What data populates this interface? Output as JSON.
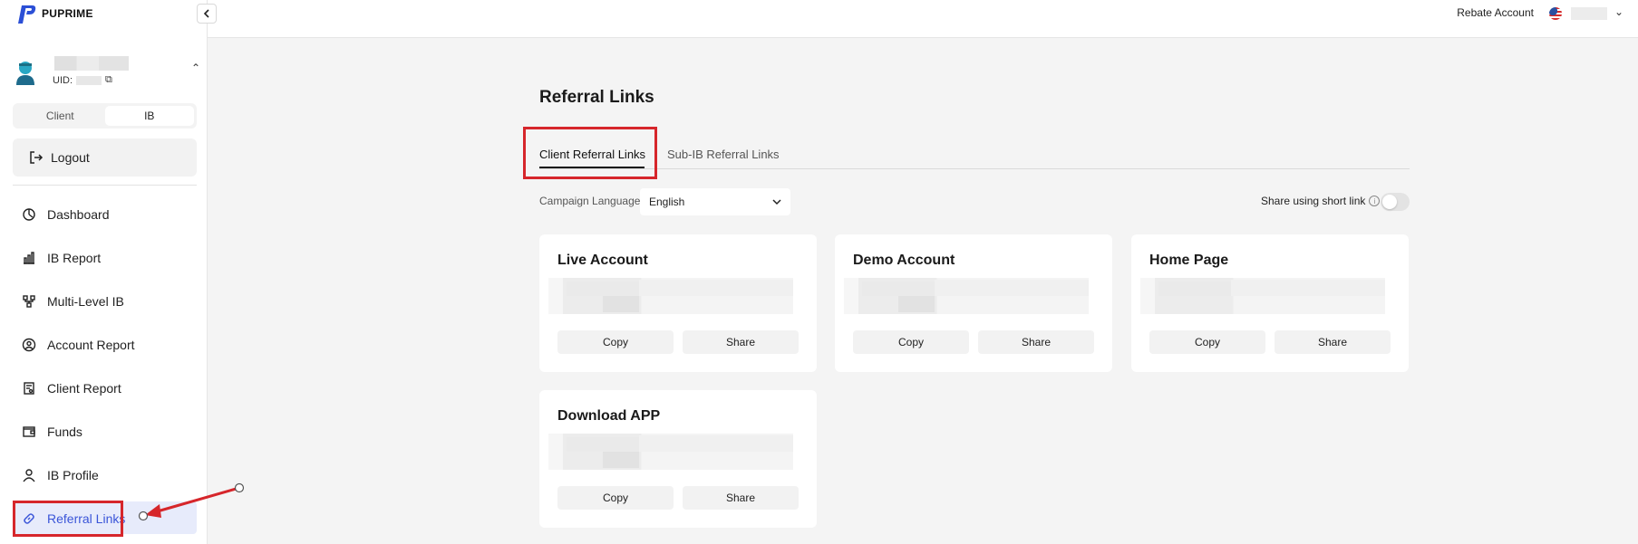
{
  "app": {
    "logo_text": "PUPRIME"
  },
  "user": {
    "uid_label": "UID:"
  },
  "role_switch": {
    "options": [
      "Client",
      "IB"
    ],
    "active": "IB"
  },
  "logout": {
    "label": "Logout"
  },
  "nav": {
    "items": [
      {
        "label": "Dashboard",
        "icon": "dashboard-icon"
      },
      {
        "label": "IB Report",
        "icon": "bar-chart-icon"
      },
      {
        "label": "Multi-Level IB",
        "icon": "hierarchy-icon"
      },
      {
        "label": "Account Report",
        "icon": "account-circle-icon"
      },
      {
        "label": "Client Report",
        "icon": "report-icon"
      },
      {
        "label": "Funds",
        "icon": "wallet-icon"
      },
      {
        "label": "IB Profile",
        "icon": "person-icon"
      },
      {
        "label": "Referral Links",
        "icon": "link-icon",
        "active": true
      }
    ]
  },
  "header": {
    "rebate_account": "Rebate Account"
  },
  "page": {
    "title": "Referral Links",
    "tabs": [
      {
        "label": "Client Referral Links",
        "active": true
      },
      {
        "label": "Sub-IB Referral Links",
        "active": false
      }
    ],
    "campaign_language_label": "Campaign Language",
    "campaign_language_value": "English",
    "share_short_link_label": "Share using short link",
    "share_short_link_enabled": false
  },
  "cards": [
    {
      "title": "Live Account",
      "copy": "Copy",
      "share": "Share"
    },
    {
      "title": "Demo Account",
      "copy": "Copy",
      "share": "Share"
    },
    {
      "title": "Home Page",
      "copy": "Copy",
      "share": "Share"
    },
    {
      "title": "Download APP",
      "copy": "Copy",
      "share": "Share"
    }
  ],
  "colors": {
    "accent": "#3a55d8",
    "annotation_red": "#d6262b",
    "active_nav_bg": "#e7ebfb"
  }
}
